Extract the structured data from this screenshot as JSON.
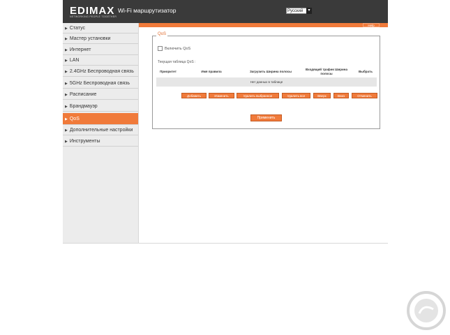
{
  "header": {
    "logo": "EDIMAX",
    "logo_tagline": "NETWORKING PEOPLE TOGETHER",
    "title": "Wi-Fi маршрутизатор",
    "language": "Русский"
  },
  "help_label": "Help",
  "sidebar": {
    "items": [
      {
        "label": "Статус"
      },
      {
        "label": "Мастер установки"
      },
      {
        "label": "Интернет"
      },
      {
        "label": "LAN"
      },
      {
        "label": "2.4GHz Беспроводная связь"
      },
      {
        "label": "5GHz Беспроводная связь"
      },
      {
        "label": "Расписание"
      },
      {
        "label": "Брандмауэр"
      },
      {
        "label": "QoS"
      },
      {
        "label": "Дополнительные настройки"
      },
      {
        "label": "Инструменты"
      }
    ],
    "active_index": 8
  },
  "qos": {
    "legend": "QoS",
    "enable_label": "Включить QoS",
    "enabled": false,
    "current_table_label": "Текущая таблица QoS :",
    "columns": [
      "Приоритет",
      "Имя правила",
      "Загрузить Ширина полосы",
      "Входящий трафик Ширина полосы",
      "Выбрать"
    ],
    "empty_message": "Нет данных в таблице",
    "buttons": [
      "Добавить",
      "Изменить",
      "Удалить выбранное",
      "Удалить все",
      "Вверх",
      "Вниз",
      "Отменить"
    ],
    "apply_label": "Применить"
  },
  "colors": {
    "accent": "#f07a3a",
    "header_bg": "#3a3a3a",
    "sidebar_bg": "#ececec"
  }
}
